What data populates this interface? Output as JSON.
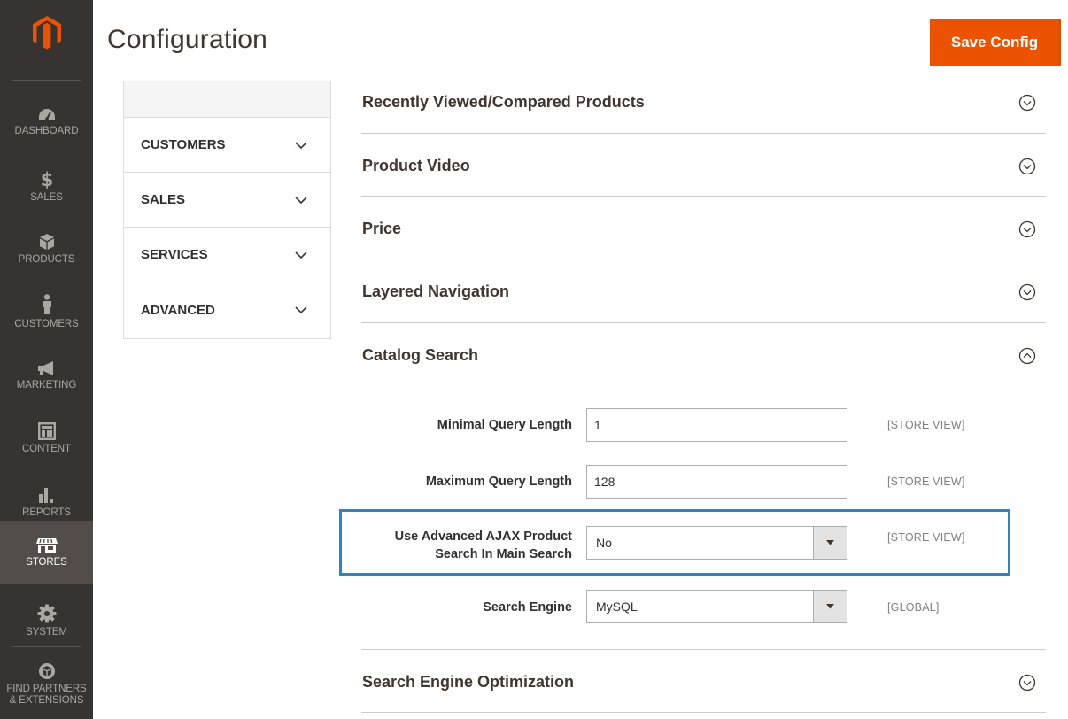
{
  "nav": {
    "items": [
      {
        "label": "DASHBOARD",
        "icon": "dashboard-icon"
      },
      {
        "label": "SALES",
        "icon": "dollar-icon"
      },
      {
        "label": "PRODUCTS",
        "icon": "cube-icon"
      },
      {
        "label": "CUSTOMERS",
        "icon": "person-icon"
      },
      {
        "label": "MARKETING",
        "icon": "megaphone-icon"
      },
      {
        "label": "CONTENT",
        "icon": "layout-icon"
      },
      {
        "label": "REPORTS",
        "icon": "bar-chart-icon"
      },
      {
        "label": "STORES",
        "icon": "storefront-icon"
      },
      {
        "label": "SYSTEM",
        "icon": "gear-icon"
      },
      {
        "label_line1": "FIND PARTNERS",
        "label_line2": "& EXTENSIONS",
        "icon": "partners-cube-icon"
      }
    ],
    "active": "STORES"
  },
  "header": {
    "title": "Configuration",
    "save_label": "Save Config"
  },
  "tabs": [
    {
      "label": "CUSTOMERS"
    },
    {
      "label": "SALES"
    },
    {
      "label": "SERVICES"
    },
    {
      "label": "ADVANCED"
    }
  ],
  "sections": [
    {
      "title": "Recently Viewed/Compared Products",
      "state": "collapsed"
    },
    {
      "title": "Product Video",
      "state": "collapsed"
    },
    {
      "title": "Price",
      "state": "collapsed"
    },
    {
      "title": "Layered Navigation",
      "state": "collapsed"
    },
    {
      "title": "Catalog Search",
      "state": "expanded"
    },
    {
      "title": "Search Engine Optimization",
      "state": "collapsed"
    }
  ],
  "catalog_search": {
    "min_query_length": {
      "label": "Minimal Query Length",
      "value": "1",
      "scope": "[STORE VIEW]"
    },
    "max_query_length": {
      "label": "Maximum Query Length",
      "value": "128",
      "scope": "[STORE VIEW]"
    },
    "ajax_search": {
      "label_line1": "Use Advanced AJAX Product",
      "label_line2": "Search In Main Search",
      "value": "No",
      "scope": "[STORE VIEW]"
    },
    "search_engine": {
      "label": "Search Engine",
      "value": "MySQL",
      "scope": "[GLOBAL]"
    }
  },
  "colors": {
    "nav_bg": "#373330",
    "accent": "#eb5202",
    "highlight": "#2d84c2"
  }
}
